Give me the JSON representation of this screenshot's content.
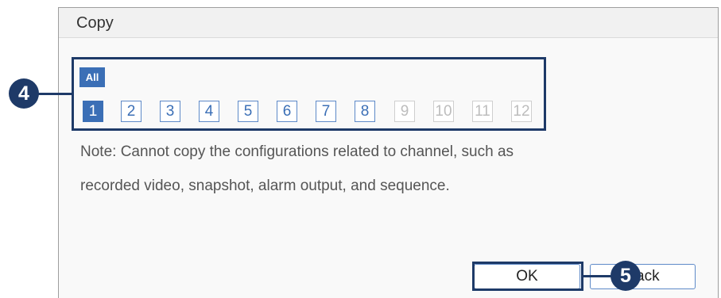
{
  "dialog": {
    "title": "Copy",
    "all_label": "All",
    "channels": [
      {
        "label": "1",
        "state": "selected"
      },
      {
        "label": "2",
        "state": "enabled"
      },
      {
        "label": "3",
        "state": "enabled"
      },
      {
        "label": "4",
        "state": "enabled"
      },
      {
        "label": "5",
        "state": "enabled"
      },
      {
        "label": "6",
        "state": "enabled"
      },
      {
        "label": "7",
        "state": "enabled"
      },
      {
        "label": "8",
        "state": "enabled"
      },
      {
        "label": "9",
        "state": "disabled"
      },
      {
        "label": "10",
        "state": "disabled"
      },
      {
        "label": "11",
        "state": "disabled"
      },
      {
        "label": "12",
        "state": "disabled"
      }
    ],
    "note_line1": "Note: Cannot copy the configurations related to channel, such as",
    "note_line2": "recorded video, snapshot, alarm output, and sequence.",
    "ok_label": "OK",
    "back_label": "Back"
  },
  "callouts": {
    "step4": "4",
    "step5": "5"
  },
  "colors": {
    "accent": "#3b6fb6",
    "callout": "#1e3a68"
  }
}
